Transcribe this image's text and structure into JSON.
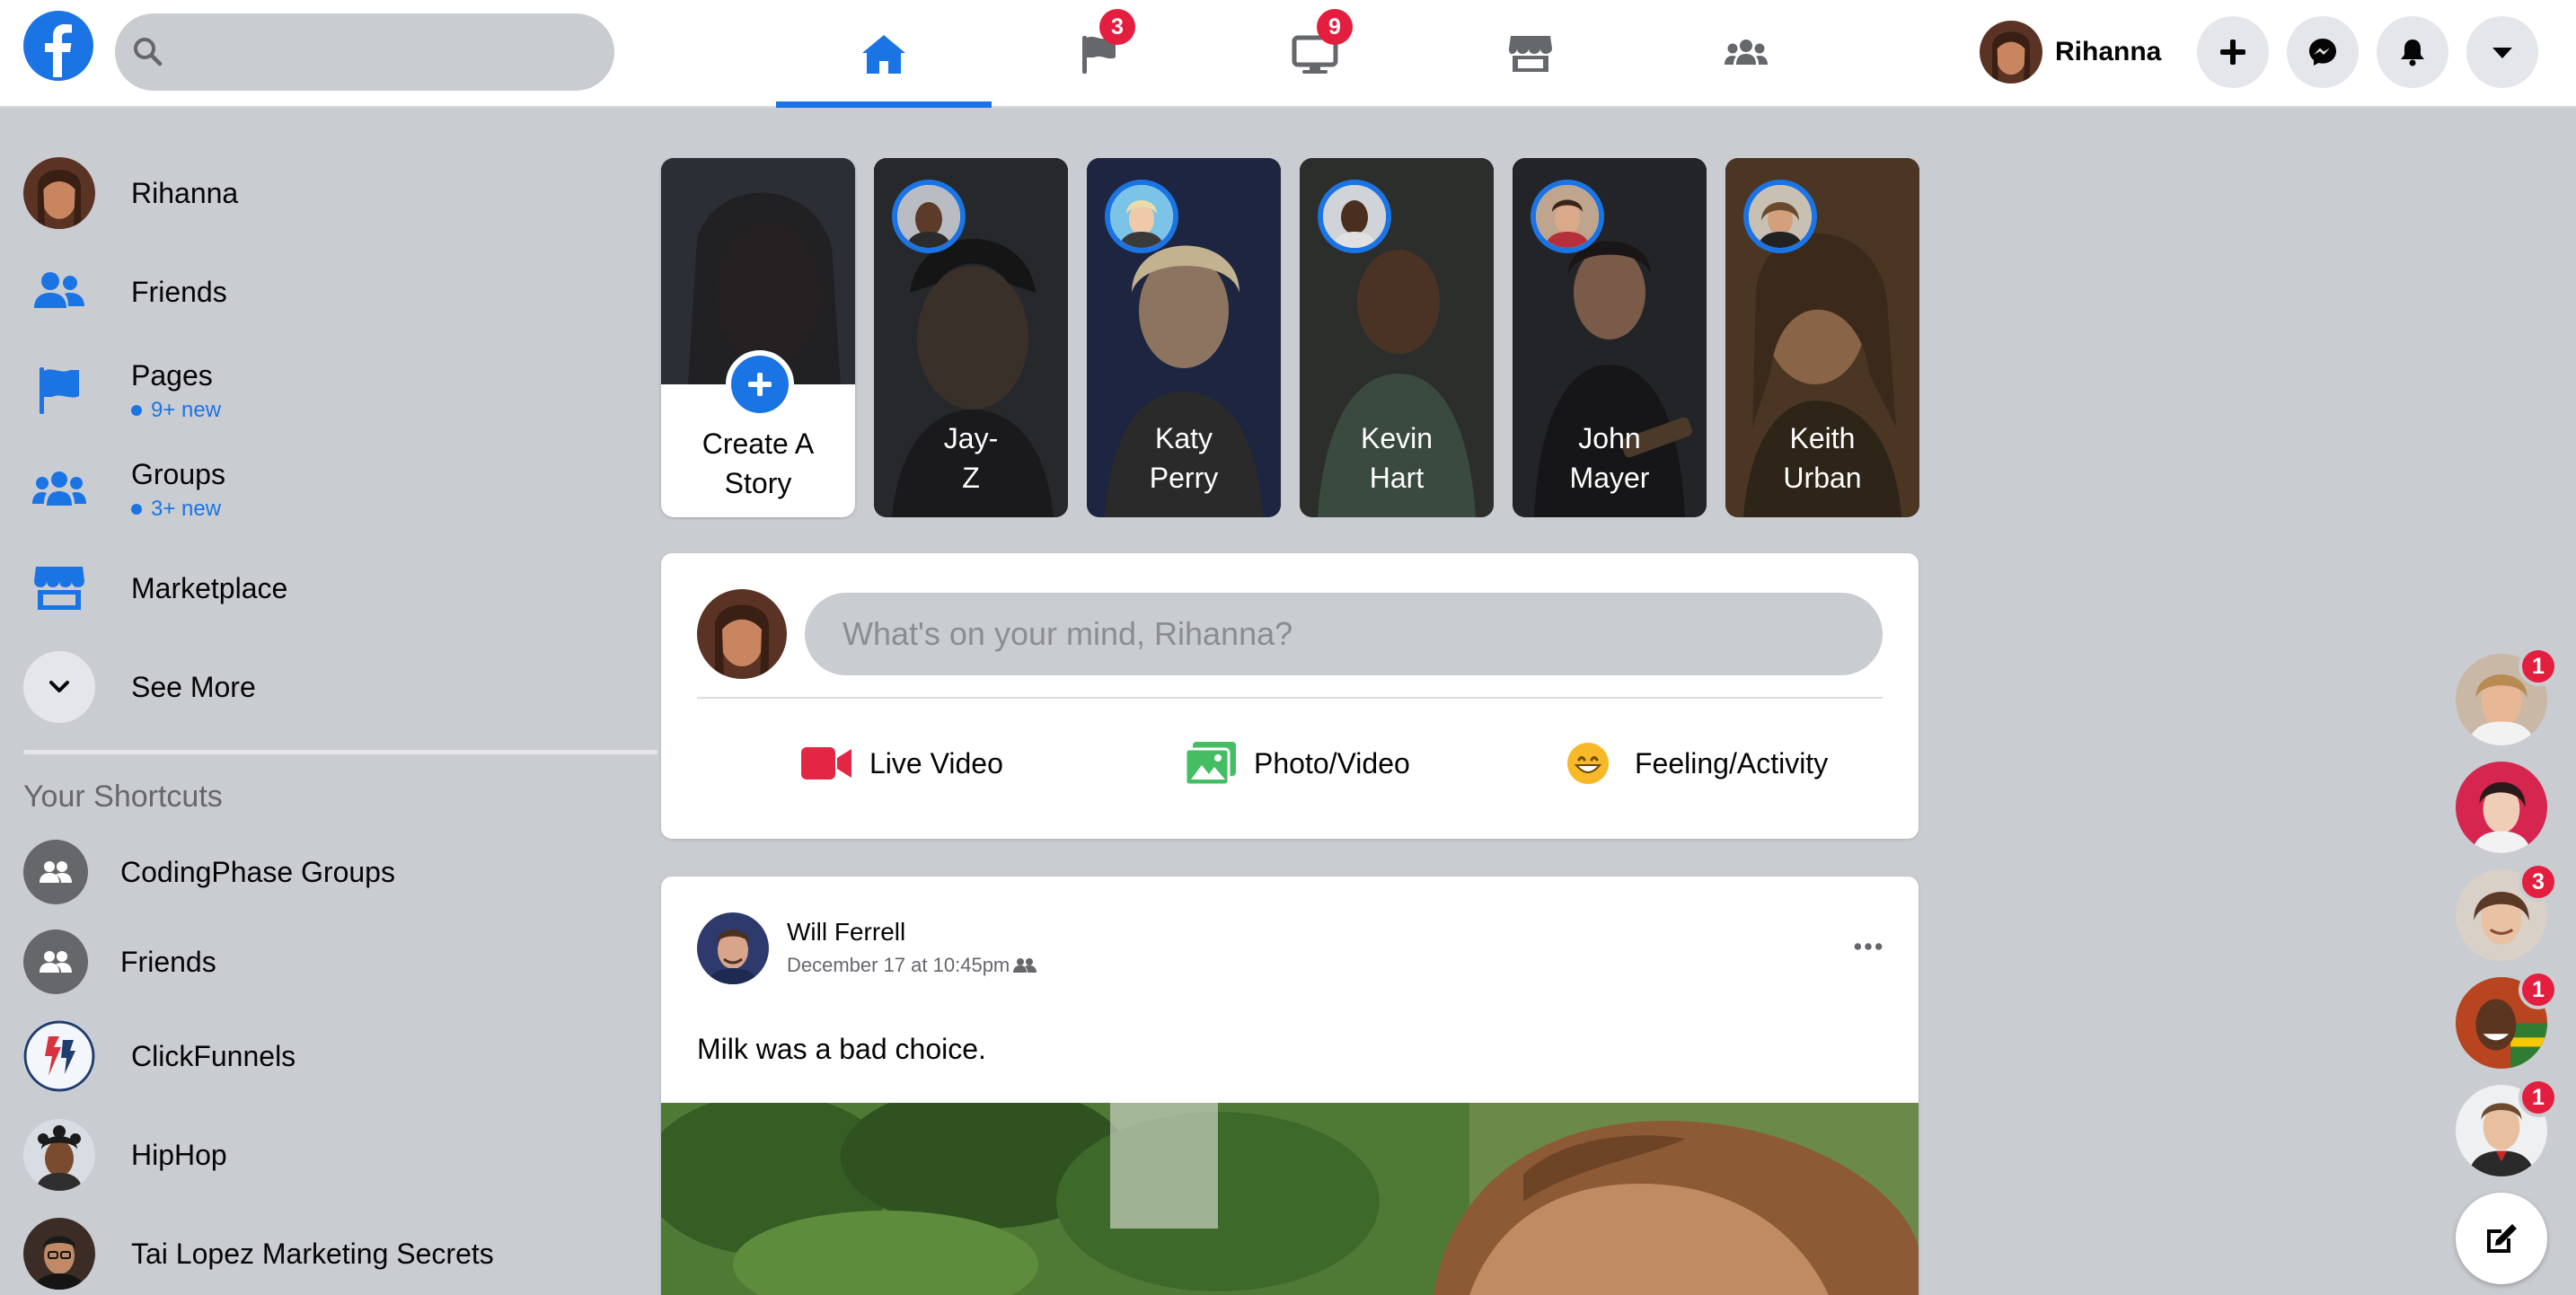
{
  "search": {
    "placeholder": ""
  },
  "nav": {
    "tabs": [
      {
        "name": "home",
        "active": true,
        "badge": ""
      },
      {
        "name": "pages",
        "active": false,
        "badge": "3"
      },
      {
        "name": "watch",
        "active": false,
        "badge": "9"
      },
      {
        "name": "marketplace",
        "active": false,
        "badge": ""
      },
      {
        "name": "groups",
        "active": false,
        "badge": ""
      }
    ],
    "profile_name": "Rihanna",
    "actions": [
      "create-icon",
      "messenger-icon",
      "bell-icon",
      "caret-down-icon"
    ]
  },
  "sidebar": {
    "items": [
      {
        "label": "Rihanna",
        "icon": "avatar"
      },
      {
        "label": "Friends",
        "icon": "friends-icon"
      },
      {
        "label": "Pages",
        "sub": "9+ new",
        "icon": "flag-icon"
      },
      {
        "label": "Groups",
        "sub": "3+ new",
        "icon": "groups-icon"
      },
      {
        "label": "Marketplace",
        "icon": "store-icon"
      },
      {
        "label": "See More",
        "icon": "chevron-down-icon"
      }
    ],
    "shortcuts_title": "Your Shortcuts",
    "shortcuts": [
      {
        "label": "CodingPhase Groups"
      },
      {
        "label": "Friends"
      },
      {
        "label": "ClickFunnels"
      },
      {
        "label": "HipHop"
      },
      {
        "label": "Tai Lopez Marketing Secrets"
      }
    ]
  },
  "stories": {
    "create_label": "Create A Story",
    "items": [
      {
        "name": "Jay-Z",
        "line1": "Jay-",
        "line2": "Z"
      },
      {
        "name": "Katy Perry",
        "line1": "Katy",
        "line2": "Perry"
      },
      {
        "name": "Kevin Hart",
        "line1": "Kevin",
        "line2": "Hart"
      },
      {
        "name": "John Mayer",
        "line1": "John",
        "line2": "Mayer"
      },
      {
        "name": "Keith Urban",
        "line1": "Keith",
        "line2": "Urban"
      }
    ]
  },
  "composer": {
    "placeholder": "What's on your mind, Rihanna?",
    "live_video": "Live Video",
    "photo_video": "Photo/Video",
    "feeling": "Feeling/Activity"
  },
  "post": {
    "author": "Will Ferrell",
    "time": "December 17 at 10:45pm",
    "text": "Milk was a bad choice."
  },
  "contacts": [
    {
      "badge": "1"
    },
    {
      "badge": ""
    },
    {
      "badge": "3"
    },
    {
      "badge": "1"
    },
    {
      "badge": "1"
    }
  ],
  "colors": {
    "brand": "#1b74e4",
    "badge": "#e41e3f",
    "background": "#c9ccd1",
    "live_video": "#e42645",
    "photo_video": "#45bd62",
    "feeling": "#f7b928"
  }
}
